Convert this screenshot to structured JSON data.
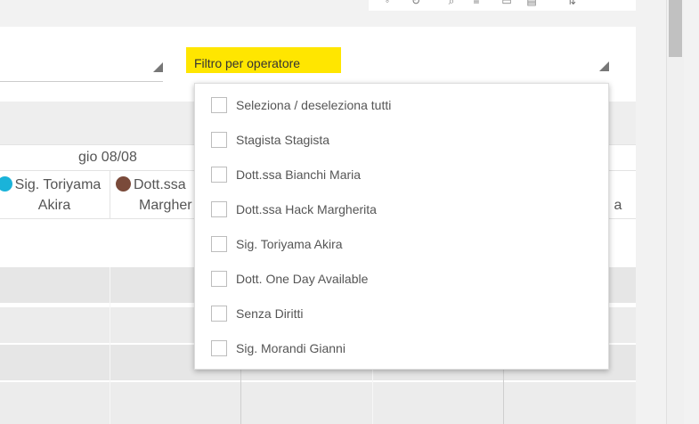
{
  "toolbar": {
    "icons": [
      "info-icon",
      "refresh-icon",
      "search-icon",
      "list-icon",
      "calendar-icon",
      "layout-icon",
      "sort-icon"
    ]
  },
  "filter": {
    "label": "Filtro per operatore"
  },
  "calendar": {
    "date_label": "gio 08/08",
    "operators": [
      {
        "line1": "Sig. Toriyama",
        "line2": "Akira",
        "color": "#1ab3d9"
      },
      {
        "line1": "Dott.ssa",
        "line2": "Margher",
        "color": "#7a4a3a"
      },
      {
        "partial": "a"
      }
    ]
  },
  "dropdown": {
    "items": [
      {
        "label": "Seleziona / deseleziona tutti",
        "checked": false
      },
      {
        "label": "Stagista Stagista",
        "checked": false
      },
      {
        "label": "Dott.ssa Bianchi Maria",
        "checked": false
      },
      {
        "label": "Dott.ssa Hack Margherita",
        "checked": false
      },
      {
        "label": "Sig. Toriyama Akira",
        "checked": false
      },
      {
        "label": "Dott. One Day Available",
        "checked": false
      },
      {
        "label": "Senza Diritti",
        "checked": false
      },
      {
        "label": "Sig. Morandi Gianni",
        "checked": false
      }
    ]
  },
  "colors": {
    "accent_yellow": "#ffe600",
    "grid_gray": "#e6e6e6"
  }
}
